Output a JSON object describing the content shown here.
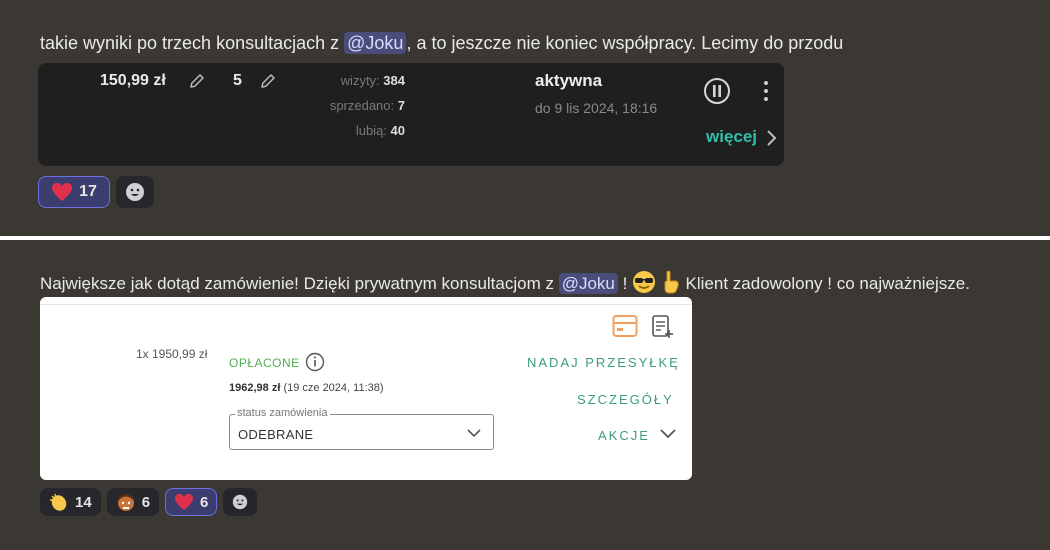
{
  "message1": {
    "text_before": "takie wyniki po trzech konsultacjach z ",
    "mention": "@Joku",
    "text_after": ", a to jeszcze nie koniec współpracy. Lecimy do przodu"
  },
  "listing": {
    "price": "150,99 zł",
    "quantity": "5",
    "visits_label": "wizyty:",
    "visits_value": "384",
    "sold_label": "sprzedano:",
    "sold_value": "7",
    "likes_label": "lubią:",
    "likes_value": "40",
    "status": "aktywna",
    "until": "do 9 lis 2024, 18:16",
    "more_label": "więcej"
  },
  "reactions1": [
    {
      "icon": "heart-icon",
      "count": "17"
    }
  ],
  "message2": {
    "text_before": "Największe jak dotąd zamówienie! Dzięki prywatnym konsultacjom z ",
    "mention": "@Joku",
    "text_mid": " !",
    "text_after": "  Klient zadowolony ! co najważniejsze."
  },
  "order": {
    "qty_price": "1x 1950,99 zł",
    "paid_label": "OPŁACONE",
    "total_amount": "1962,98 zł",
    "total_date": "(19 cze 2024, 11:38)",
    "select_legend": "status zamówienia",
    "select_value": "ODEBRANE",
    "ship_label": "NADAJ PRZESYŁKĘ",
    "details_label": "SZCZEGÓŁY",
    "actions_label": "AKCJE"
  },
  "reactions2": [
    {
      "icon": "clap-icon",
      "count": "14"
    },
    {
      "icon": "face-icon",
      "count": "6"
    },
    {
      "icon": "heart-icon",
      "count": "6"
    }
  ],
  "colors": {
    "background": "#3b3833",
    "accent_teal": "#2fbfa8",
    "paid_green": "#4caf50",
    "heart_red": "#e0304a",
    "mention_bg": "#4a4c7a"
  }
}
